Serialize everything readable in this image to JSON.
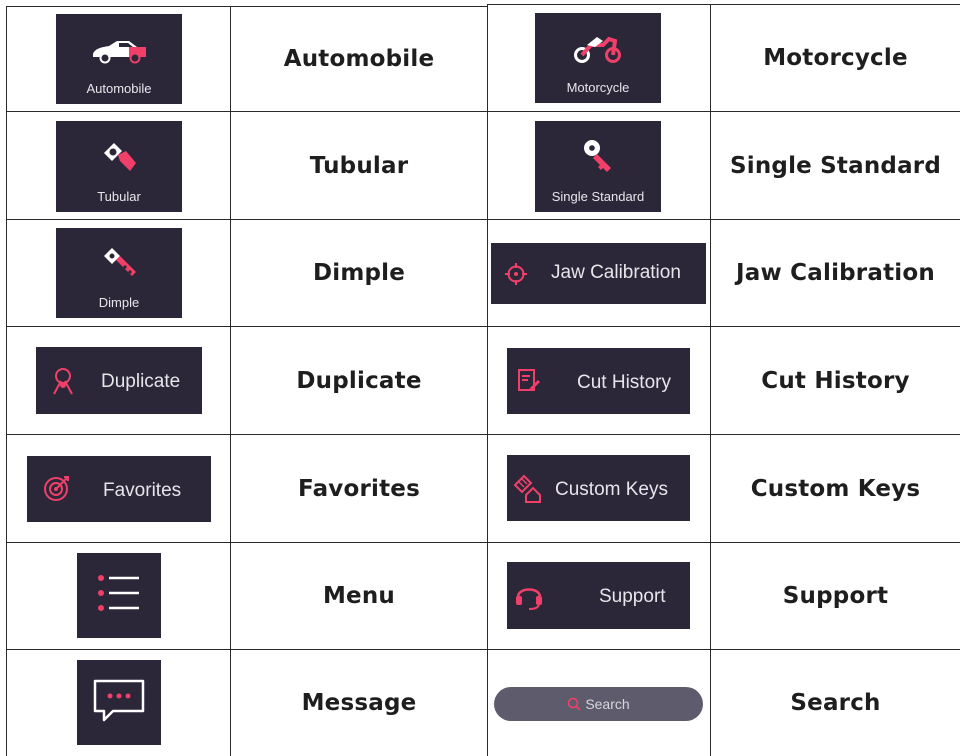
{
  "rows": [
    {
      "left_button": "Automobile",
      "left_label": "Automobile",
      "right_button": "Motorcycle",
      "right_label": "Motorcycle"
    },
    {
      "left_button": "Tubular",
      "left_label": "Tubular",
      "right_button": "Single Standard",
      "right_label": "Single Standard"
    },
    {
      "left_button": "Dimple",
      "left_label": "Dimple",
      "right_button": "Jaw Calibration",
      "right_label": "Jaw Calibration"
    },
    {
      "left_button": "Duplicate",
      "left_label": "Duplicate",
      "right_button": "Cut History",
      "right_label": "Cut History"
    },
    {
      "left_button": "Favorites",
      "left_label": "Favorites",
      "right_button": "Custom Keys",
      "right_label": "Custom Keys"
    },
    {
      "left_button": "",
      "left_label": "Menu",
      "right_button": "Support",
      "right_label": "Support"
    },
    {
      "left_button": "",
      "left_label": "Message",
      "right_button": "Search",
      "right_label": "Search"
    }
  ],
  "icons": {
    "automobile": "car-icon",
    "motorcycle": "motorcycle-icon",
    "tubular": "tubular-key-icon",
    "single_standard": "single-key-icon",
    "dimple": "dimple-key-icon",
    "jaw_calibration": "crosshair-icon",
    "duplicate": "duplicate-key-icon",
    "cut_history": "history-document-icon",
    "favorites": "target-icon",
    "custom_keys": "custom-key-icon",
    "menu": "menu-list-icon",
    "message": "chat-bubble-icon",
    "support": "headset-icon",
    "search": "search-icon"
  },
  "colors": {
    "button_bg": "#2b2739",
    "accent": "#f0406a",
    "search_bg": "#5d5b6c"
  }
}
